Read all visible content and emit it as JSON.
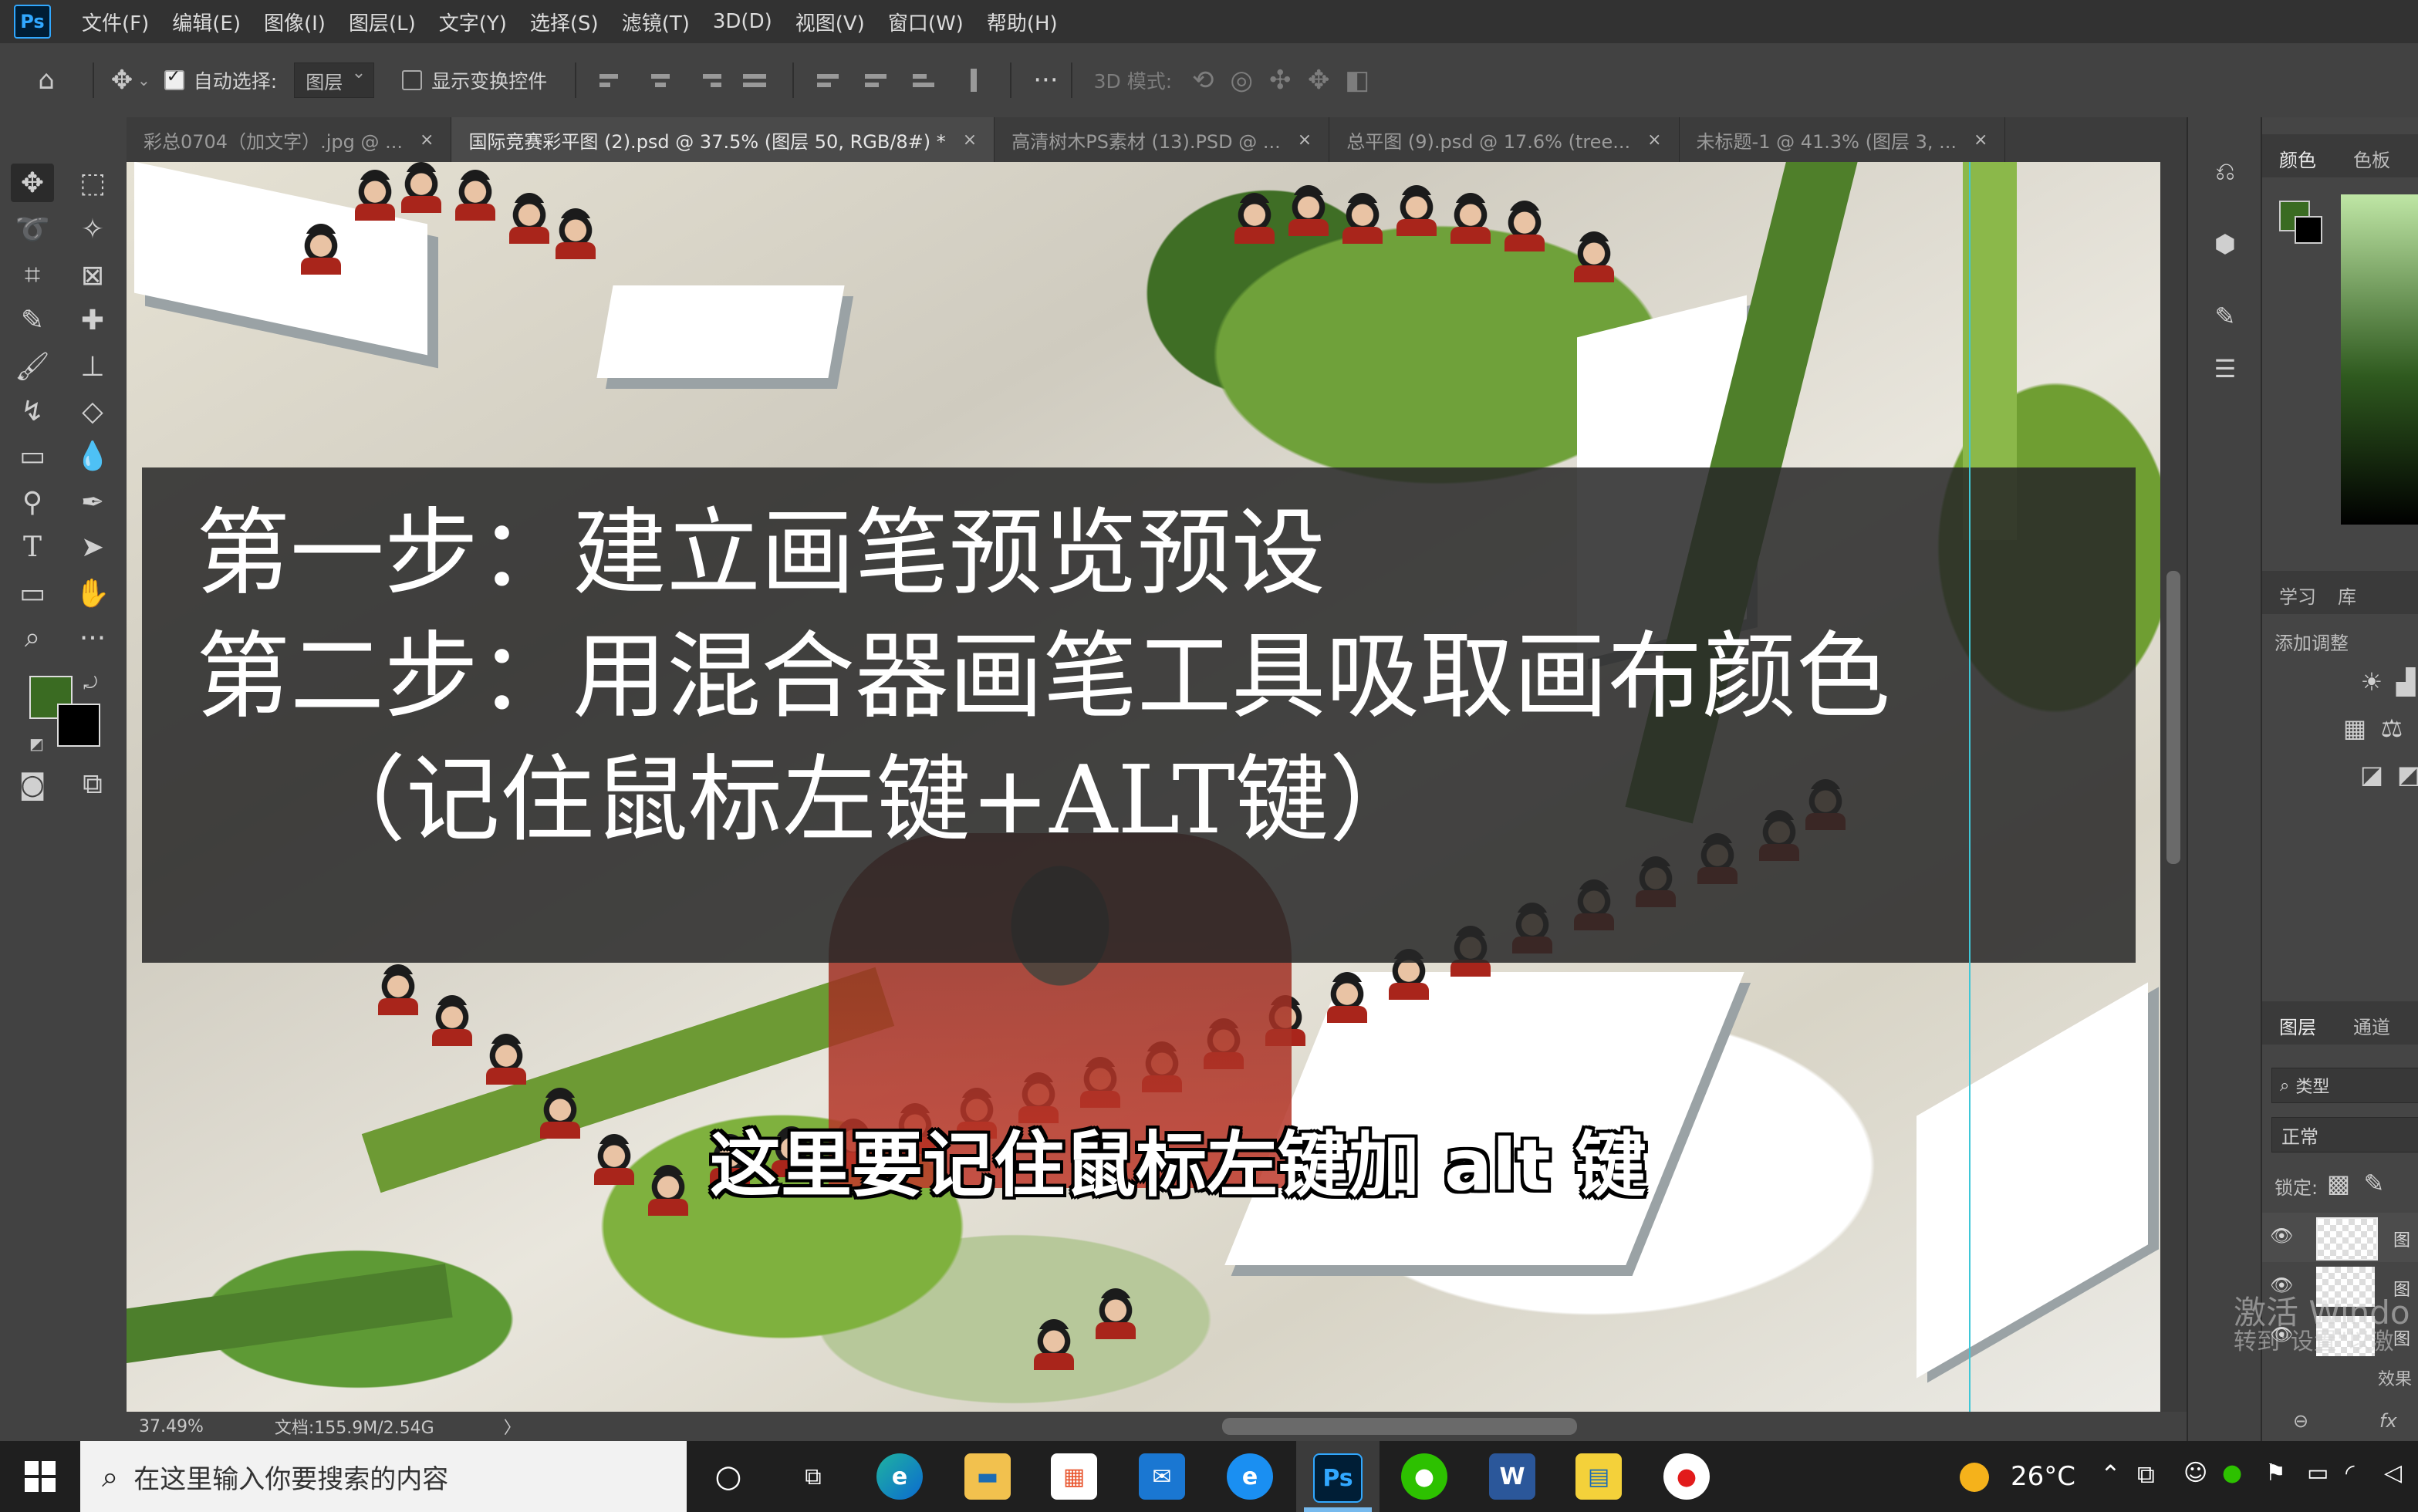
{
  "app": {
    "logo": "Ps"
  },
  "menu": [
    "文件(F)",
    "编辑(E)",
    "图像(I)",
    "图层(L)",
    "文字(Y)",
    "选择(S)",
    "滤镜(T)",
    "3D(D)",
    "视图(V)",
    "窗口(W)",
    "帮助(H)"
  ],
  "options": {
    "auto_select_label": "自动选择:",
    "auto_select_checked": true,
    "auto_select_target": "图层",
    "show_transform_label": "显示变换控件",
    "show_transform_checked": false,
    "mode_3d_label": "3D 模式:",
    "more": "···"
  },
  "tabs": [
    {
      "label": "彩总0704（加文字）.jpg @ ...",
      "active": false
    },
    {
      "label": "国际竞赛彩平图 (2).psd @ 37.5% (图层 50, RGB/8#) *",
      "active": true
    },
    {
      "label": "高清树木PS素材 (13).PSD @ ...",
      "active": false
    },
    {
      "label": "总平图 (9).psd @ 17.6% (tree...",
      "active": false
    },
    {
      "label": "未标题-1 @ 41.3% (图层 3, ...",
      "active": false
    }
  ],
  "tab_close": "×",
  "colors": {
    "foreground": "#3a6b22",
    "background": "#000000",
    "accent_ps": "#31a8ff"
  },
  "slide": {
    "line1": "第一步：建立画笔预览预设",
    "line2": "第二步：用混合器画笔工具吸取画布颜色",
    "line3": "（记住鼠标左键+ALT键）"
  },
  "subtitle": "这里要记住鼠标左键加 alt 键",
  "status": {
    "zoom": "37.49%",
    "doc": "文档:155.9M/2.54G",
    "arrow": "〉"
  },
  "panels": {
    "color_tab": "颜色",
    "swatches_tab": "色板",
    "learn_tab": "学习",
    "library_tab": "库",
    "adjust_label": "添加调整",
    "layers_tab": "图层",
    "channels_tab": "通道",
    "filter_kind": "类型",
    "blend_mode": "正常",
    "lock_label": "锁定:",
    "layer_suffix": "图",
    "effects_label": "效果",
    "fx_label": "fx"
  },
  "watermark": {
    "line1": "激活 Windo",
    "line2": "转到\"设置\"以激"
  },
  "taskbar": {
    "search_placeholder": "在这里输入你要搜索的内容",
    "weather": "26°C",
    "apps": [
      {
        "name": "cortana",
        "icon": "○"
      },
      {
        "name": "task-view",
        "icon": "⧉"
      },
      {
        "name": "edge",
        "icon": "e"
      },
      {
        "name": "file-explorer",
        "icon": "▬"
      },
      {
        "name": "store",
        "icon": "▦"
      },
      {
        "name": "mail",
        "icon": "✉"
      },
      {
        "name": "ie",
        "icon": "e"
      },
      {
        "name": "photoshop",
        "icon": "Ps"
      },
      {
        "name": "wechat",
        "icon": "●"
      },
      {
        "name": "word",
        "icon": "W"
      },
      {
        "name": "notepad",
        "icon": "▤"
      },
      {
        "name": "recorder",
        "icon": "●"
      }
    ]
  }
}
